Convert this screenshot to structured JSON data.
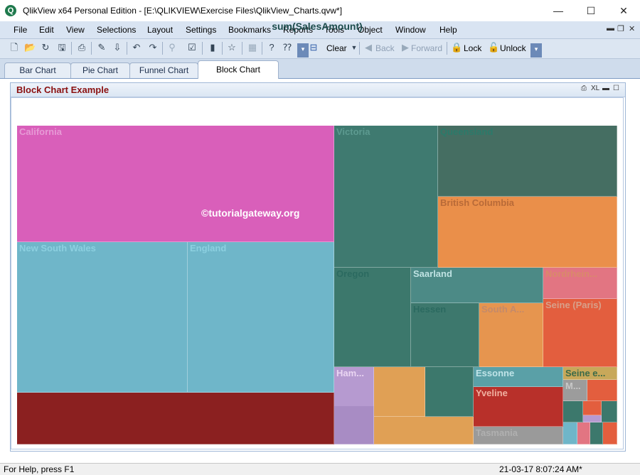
{
  "window": {
    "title": "QlikView x64 Personal Edition - [E:\\QLIKVIEW\\Exercise Files\\QlikView_Charts.qvw*]",
    "app_icon_letter": "Q",
    "minimize": "—",
    "maximize": "☐",
    "close": "✕"
  },
  "menu": [
    "File",
    "Edit",
    "View",
    "Selections",
    "Layout",
    "Settings",
    "Bookmarks",
    "Reports",
    "Tools",
    "Object",
    "Window",
    "Help"
  ],
  "toolbar": {
    "clear": "Clear",
    "back": "Back",
    "forward": "Forward",
    "lock": "Lock",
    "unlock": "Unlock"
  },
  "tabs": [
    {
      "label": "Bar Chart",
      "active": false
    },
    {
      "label": "Pie Chart",
      "active": false
    },
    {
      "label": "Funnel Chart",
      "active": false
    },
    {
      "label": "Block Chart",
      "active": true
    }
  ],
  "chart_object": {
    "caption": "Block Chart Example",
    "xl_label": "XL",
    "expression_title": "sum(SalesAmount)",
    "watermark": "©tutorialgateway.org"
  },
  "chart_data": {
    "type": "treemap",
    "title": "sum(SalesAmount)",
    "blocks": [
      {
        "label": "California",
        "color": "#d95fba"
      },
      {
        "label": "New South Wales",
        "color": "#6fb6c9"
      },
      {
        "label": "England",
        "color": "#6fb6c9"
      },
      {
        "label": "",
        "color": "#8b2020"
      },
      {
        "label": "Victoria",
        "color": "#3f7a70"
      },
      {
        "label": "Queensland",
        "color": "#456e62"
      },
      {
        "label": "British Columbia",
        "color": "#ea8f4a"
      },
      {
        "label": "Oregon",
        "color": "#3c786c"
      },
      {
        "label": "Saarland",
        "color": "#4c8a86"
      },
      {
        "label": "Hessen",
        "color": "#3d786d"
      },
      {
        "label": "South A...",
        "color": "#e6954f"
      },
      {
        "label": "Nordrhein...",
        "color": "#e27582"
      },
      {
        "label": "Seine (Paris)",
        "color": "#e35e3e"
      },
      {
        "label": "Ham...",
        "color": "#b69ad0"
      },
      {
        "label": "Essonne",
        "color": "#5aa0a7"
      },
      {
        "label": "Yveline",
        "color": "#b8302a"
      },
      {
        "label": "Tasmania",
        "color": "#9a9a9a"
      },
      {
        "label": "Seine e...",
        "color": "#c8a85a"
      },
      {
        "label": "M...",
        "color": "#9c9c9c"
      }
    ]
  },
  "status": {
    "left": "For Help, press F1",
    "right": "21-03-17 8:07:24 AM*"
  }
}
